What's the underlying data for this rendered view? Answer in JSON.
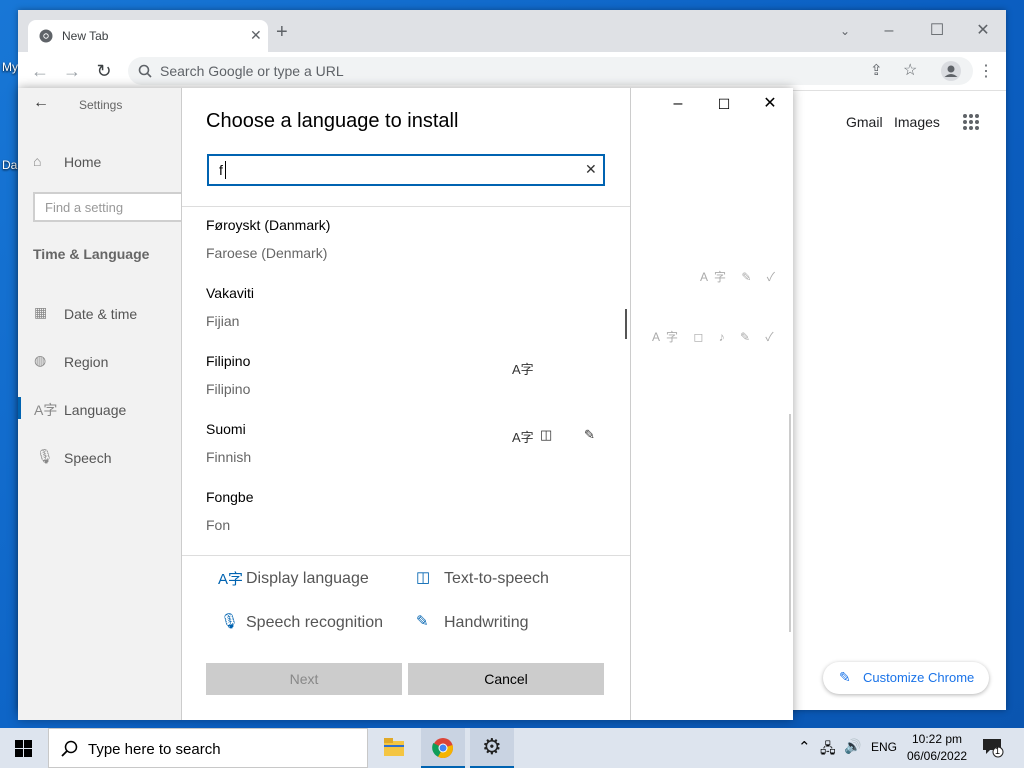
{
  "desktop": {
    "icons": [
      "My",
      "Da"
    ]
  },
  "chrome": {
    "tab_title": "New Tab",
    "omnibox_placeholder": "Search Google or type a URL",
    "links": {
      "gmail": "Gmail",
      "images": "Images"
    },
    "customize_label": "Customize Chrome"
  },
  "settings": {
    "title": "Settings",
    "home": "Home",
    "search_placeholder": "Find a setting",
    "section": "Time & Language",
    "nav": [
      {
        "label": "Date & time",
        "icon": "calendar-icon"
      },
      {
        "label": "Region",
        "icon": "globe-icon"
      },
      {
        "label": "Language",
        "icon": "language-icon"
      },
      {
        "label": "Speech",
        "icon": "microphone-icon"
      }
    ]
  },
  "dialog": {
    "title": "Choose a language to install",
    "search_value": "f",
    "languages": [
      {
        "name": "Føroyskt (Danmark)",
        "english": "Faroese (Denmark)",
        "features": []
      },
      {
        "name": "Vakaviti",
        "english": "Fijian",
        "features": []
      },
      {
        "name": "Filipino",
        "english": "Filipino",
        "features": [
          "display-language-icon"
        ]
      },
      {
        "name": "Suomi",
        "english": "Finnish",
        "features": [
          "display-language-icon",
          "text-to-speech-icon",
          "handwriting-icon"
        ]
      },
      {
        "name": "Fongbe",
        "english": "Fon",
        "features": []
      }
    ],
    "legend": {
      "display_language": "Display language",
      "text_to_speech": "Text-to-speech",
      "speech_recognition": "Speech recognition",
      "handwriting": "Handwriting"
    },
    "next_label": "Next",
    "cancel_label": "Cancel"
  },
  "taskbar": {
    "search_placeholder": "Type here to search",
    "lang": "ENG",
    "time": "10:22 pm",
    "date": "06/06/2022",
    "notification_count": "1"
  }
}
